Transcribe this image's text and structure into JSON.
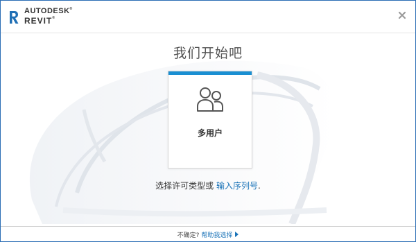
{
  "app": {
    "brand_line1": "AUTODESK",
    "brand_line2": "REVIT",
    "trademark": "®"
  },
  "colors": {
    "accent": "#1a8fd2",
    "link": "#1a73b8",
    "window_border": "#2a6db5",
    "logo": "#1f6fb5"
  },
  "icons": {
    "logo": "revit-r-logo",
    "close": "close-x",
    "license": "two-users",
    "footer_link": "caret-right"
  },
  "main": {
    "heading": "我们开始吧",
    "license_card": {
      "label": "多用户"
    },
    "prompt": {
      "prefix": "选择许可类型或 ",
      "link": "输入序列号",
      "suffix": "."
    }
  },
  "footer": {
    "question": "不确定? ",
    "help_link": "帮助我选择"
  }
}
